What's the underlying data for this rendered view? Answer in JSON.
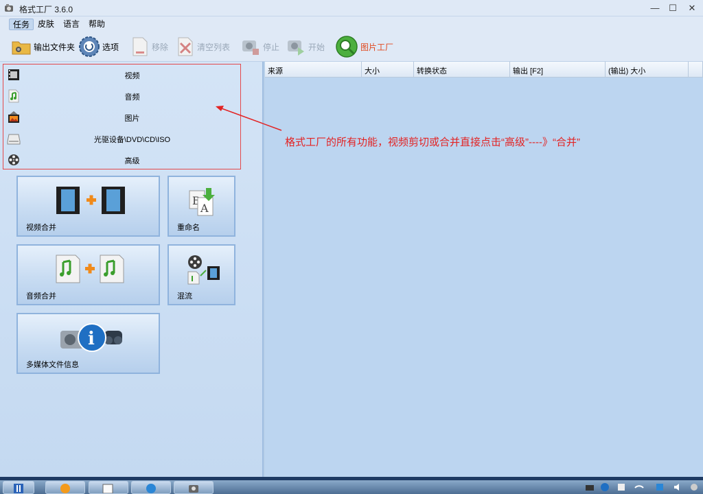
{
  "window": {
    "title": "格式工厂 3.6.0"
  },
  "menu": {
    "items": [
      "任务",
      "皮肤",
      "语言",
      "帮助"
    ]
  },
  "toolbar": {
    "output_folder": "输出文件夹",
    "options": "选项",
    "remove": "移除",
    "clear_list": "清空列表",
    "stop": "停止",
    "start": "开始",
    "picture_factory": "图片工厂"
  },
  "categories": [
    "视频",
    "音频",
    "图片",
    "光驱设备\\DVD\\CD\\ISO",
    "高级"
  ],
  "tiles": {
    "video_merge": "视频合并",
    "rename": "重命名",
    "audio_merge": "音频合并",
    "mux": "混流",
    "media_info": "多媒体文件信息"
  },
  "filelist": {
    "columns": [
      "来源",
      "大小",
      "转换状态",
      "输出 [F2]",
      "(输出) 大小"
    ]
  },
  "annotation": {
    "text": "格式工厂的所有功能，视频剪切或合并直接点击“高级”----》“合并”"
  },
  "colors": {
    "annotation": "#e32323",
    "accent": "#e0481d"
  }
}
